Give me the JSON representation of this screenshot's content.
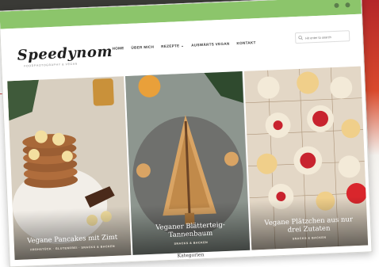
{
  "site": {
    "logo": "Speedynom",
    "tagline": "FOODPHOTOGRAPHY & VEGAN",
    "nav": [
      {
        "label": "HOME"
      },
      {
        "label": "ÜBER MICH"
      },
      {
        "label": "REZEPTE ⌄"
      },
      {
        "label": "AUSWÄRTS VEGAN"
      },
      {
        "label": "KONTAKT"
      }
    ],
    "search_placeholder": "Hit enter to search"
  },
  "posts": [
    {
      "title": "Vegane Pancakes mit Zimt",
      "category": "FRÜHSTÜCK · GLUTENFREI · SNACKS & BACKEN"
    },
    {
      "title": "Veganer Blätterteig-Tannenbaum",
      "category": "SNACKS & BACKEN"
    },
    {
      "title": "Vegane Plätzchen aus nur drei Zutaten",
      "category": "SNACKS & BACKEN"
    }
  ],
  "section_heading": "Kategorien",
  "colors": {
    "topbar": "#8cc56b",
    "accent_red": "#b4262a"
  }
}
